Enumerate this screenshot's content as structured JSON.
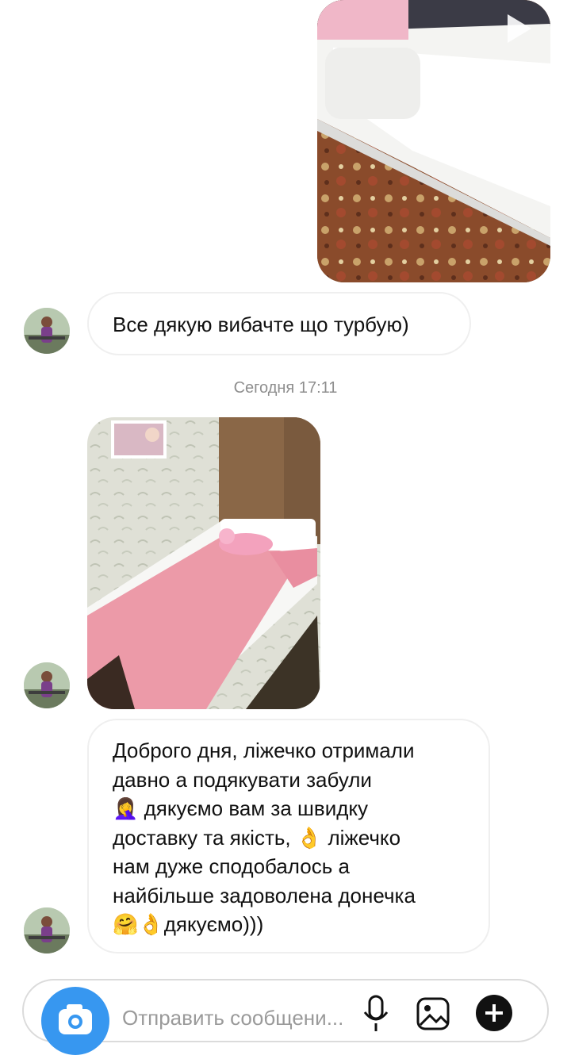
{
  "conversation": {
    "messages": [
      {
        "type": "image",
        "side": "outgoing",
        "alt": "white bed frame with pink headboard on patterned carpet"
      },
      {
        "type": "text",
        "side": "incoming",
        "text": "Все дякую вибачте що турбую)"
      },
      {
        "type": "timestamp",
        "text": "Сегодня 17:11"
      },
      {
        "type": "image",
        "side": "incoming",
        "alt": "white toddler bed with pink blanket and unicorn plush"
      },
      {
        "type": "text",
        "side": "incoming",
        "lines": [
          "Доброго дня, ліжечко отримали",
          "давно а подякувати забули",
          "🤦‍♀️ дякуємо вам за швидку",
          "доставку та якість, 👌 ліжечко",
          "нам дуже сподобалось а",
          "найбільше задоволена донечка",
          "🤗👌дякуємо)))"
        ]
      }
    ]
  },
  "composer": {
    "placeholder": "Отправить сообщени...",
    "icons": [
      "camera-icon",
      "microphone-icon",
      "gallery-icon",
      "plus-icon"
    ],
    "accent": "#3797f0"
  },
  "icons": {
    "video_play": "play-icon"
  }
}
